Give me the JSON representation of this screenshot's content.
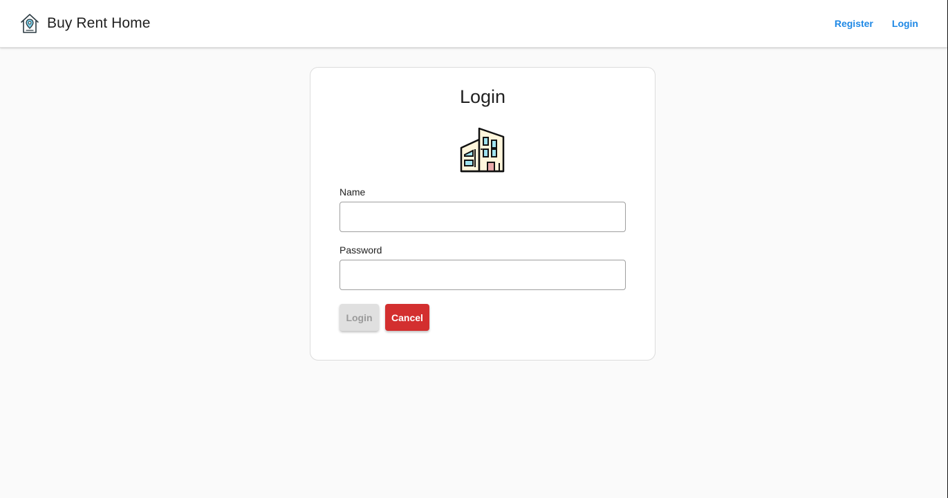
{
  "header": {
    "brand_title": "Buy Rent Home",
    "brand_icon": "house-location-icon",
    "nav": {
      "register_label": "Register",
      "login_label": "Login"
    },
    "link_color": "#1e88e5"
  },
  "login_card": {
    "title": "Login",
    "illustration": "building-icon",
    "name_field": {
      "label": "Name",
      "value": "",
      "placeholder": ""
    },
    "password_field": {
      "label": "Password",
      "value": "",
      "placeholder": ""
    },
    "buttons": {
      "login_label": "Login",
      "cancel_label": "Cancel"
    },
    "colors": {
      "cancel": "#d32f2f",
      "login_disabled": "#e0e0e0"
    }
  }
}
